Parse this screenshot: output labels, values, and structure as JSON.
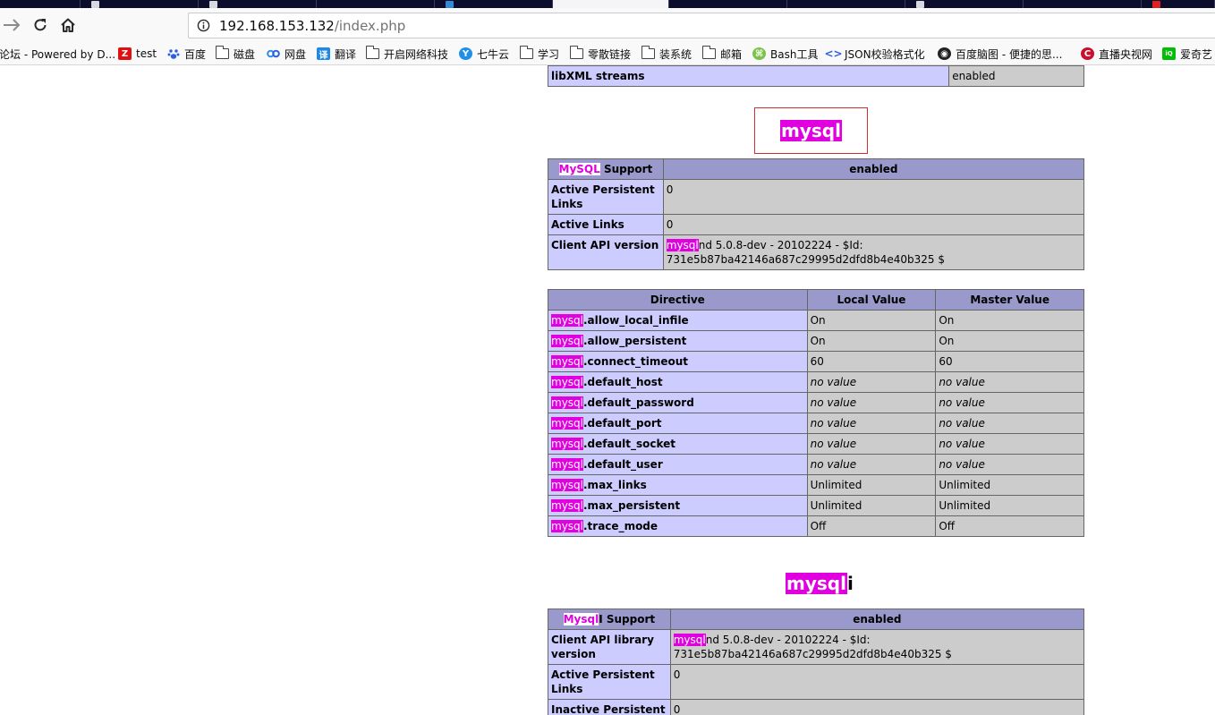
{
  "browser": {
    "url_host": "192.168.153.132",
    "url_path": "/index.php",
    "bookmarks": [
      {
        "label": "论坛 - Powered by D...",
        "icon": "none"
      },
      {
        "label": "test",
        "icon": "z-logo-icon"
      },
      {
        "label": "百度",
        "icon": "baidu-paw-icon"
      },
      {
        "label": "磁盘",
        "icon": "folder-icon"
      },
      {
        "label": "网盘",
        "icon": "baidu-netdisk-icon"
      },
      {
        "label": "翻译",
        "icon": "translate-icon"
      },
      {
        "label": "开启网络科技",
        "icon": "folder-icon"
      },
      {
        "label": "七牛云",
        "icon": "qiniu-icon"
      },
      {
        "label": "学习",
        "icon": "folder-icon"
      },
      {
        "label": "零散链接",
        "icon": "folder-icon"
      },
      {
        "label": "装系统",
        "icon": "folder-icon"
      },
      {
        "label": "邮箱",
        "icon": "folder-icon"
      },
      {
        "label": "Bash工具",
        "icon": "bash-tool-icon"
      },
      {
        "label": "JSON校验格式化",
        "icon": "json-icon"
      },
      {
        "label": "百度脑图 - 便捷的思...",
        "icon": "baidu-naotu-icon"
      },
      {
        "label": "直播央视网",
        "icon": "cctv-icon"
      },
      {
        "label": "爱奇艺",
        "icon": "iqiyi-icon"
      }
    ]
  },
  "colors": {
    "highlight": "#e000e0",
    "header_row": "#9999cc",
    "key_cell": "#ccccff",
    "value_cell": "#cccccc",
    "title_box_border": "#d03030"
  },
  "top_row": {
    "key": "libXML streams",
    "value": "enabled"
  },
  "mysql": {
    "title": "mysql",
    "support": {
      "hl": "MySQL",
      "rest": " Support",
      "status": "enabled"
    },
    "rows": [
      {
        "key": "Active Persistent Links",
        "value": "0"
      },
      {
        "key": "Active Links",
        "value": "0"
      }
    ],
    "client_api": {
      "key": "Client API version",
      "hl": "mysql",
      "rest": "nd 5.0.8-dev - 20102224 - $Id: 731e5b87ba42146a687c29995d2dfd8b4e40b325 $"
    },
    "directive_header": {
      "directive": "Directive",
      "local": "Local Value",
      "master": "Master Value"
    },
    "directives": [
      {
        "prefix": "mysql",
        "name": ".allow_local_infile",
        "local": "On",
        "master": "On",
        "italic": false
      },
      {
        "prefix": "mysql",
        "name": ".allow_persistent",
        "local": "On",
        "master": "On",
        "italic": false
      },
      {
        "prefix": "mysql",
        "name": ".connect_timeout",
        "local": "60",
        "master": "60",
        "italic": false
      },
      {
        "prefix": "mysql",
        "name": ".default_host",
        "local": "no value",
        "master": "no value",
        "italic": true
      },
      {
        "prefix": "mysql",
        "name": ".default_password",
        "local": "no value",
        "master": "no value",
        "italic": true
      },
      {
        "prefix": "mysql",
        "name": ".default_port",
        "local": "no value",
        "master": "no value",
        "italic": true
      },
      {
        "prefix": "mysql",
        "name": ".default_socket",
        "local": "no value",
        "master": "no value",
        "italic": true
      },
      {
        "prefix": "mysql",
        "name": ".default_user",
        "local": "no value",
        "master": "no value",
        "italic": true
      },
      {
        "prefix": "mysql",
        "name": ".max_links",
        "local": "Unlimited",
        "master": "Unlimited",
        "italic": false
      },
      {
        "prefix": "mysql",
        "name": ".max_persistent",
        "local": "Unlimited",
        "master": "Unlimited",
        "italic": false
      },
      {
        "prefix": "mysql",
        "name": ".trace_mode",
        "local": "Off",
        "master": "Off",
        "italic": false
      }
    ]
  },
  "mysqli": {
    "title_hl": "mysql",
    "title_rest": "i",
    "support": {
      "hl": "Mysql",
      "rest": "I Support",
      "status": "enabled"
    },
    "client_api": {
      "key": "Client API library version",
      "hl": "mysql",
      "rest": "nd 5.0.8-dev - 20102224 - $Id: 731e5b87ba42146a687c29995d2dfd8b4e40b325 $"
    },
    "rows": [
      {
        "key": "Active Persistent Links",
        "value": "0"
      },
      {
        "key": "Inactive Persistent Links",
        "value": "0"
      }
    ]
  }
}
